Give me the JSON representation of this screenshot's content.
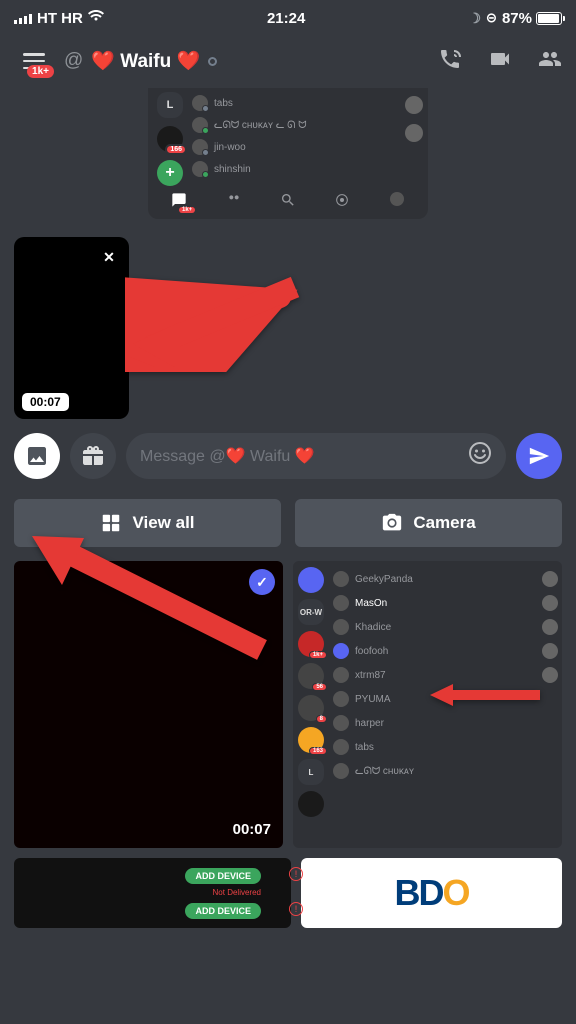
{
  "status": {
    "carrier": "HT HR",
    "time": "21:24",
    "battery": "87%"
  },
  "header": {
    "at": "@",
    "name_prefix": "❤️ ",
    "name": "Waifu",
    "name_suffix": " ❤️",
    "notification_badge": "1k+"
  },
  "embed_top": {
    "servers": {
      "badge_166": "166"
    },
    "users": [
      "tabs",
      "ᓚᘏᗢ ᴄʜᴜᴋᴀʏ ᓚ ᘏ ᗢ",
      "jin-woo",
      "shinshin"
    ],
    "nav_badge": "1k+"
  },
  "attachment": {
    "duration": "00:07",
    "close": "✕"
  },
  "input": {
    "placeholder": "Message @❤️ Waifu ❤️"
  },
  "actions": {
    "view_all": "View all",
    "camera": "Camera"
  },
  "gallery": {
    "selected_duration": "00:07",
    "right_users": [
      "GeekyPanda",
      "MasOn",
      "Khadice",
      "foofooh",
      "xtrm87",
      "PYUMA",
      "harper",
      "tabs",
      "ᓚᘏᗢ ᴄʜᴜᴋᴀʏ"
    ],
    "server_badges": [
      "1k+",
      "56",
      "8",
      "163"
    ]
  },
  "bottom": {
    "add_device": "ADD DEVICE",
    "not_delivered": "Not Delivered",
    "bdo_b": "B",
    "bdo_d": "D",
    "bdo_o": "O"
  }
}
